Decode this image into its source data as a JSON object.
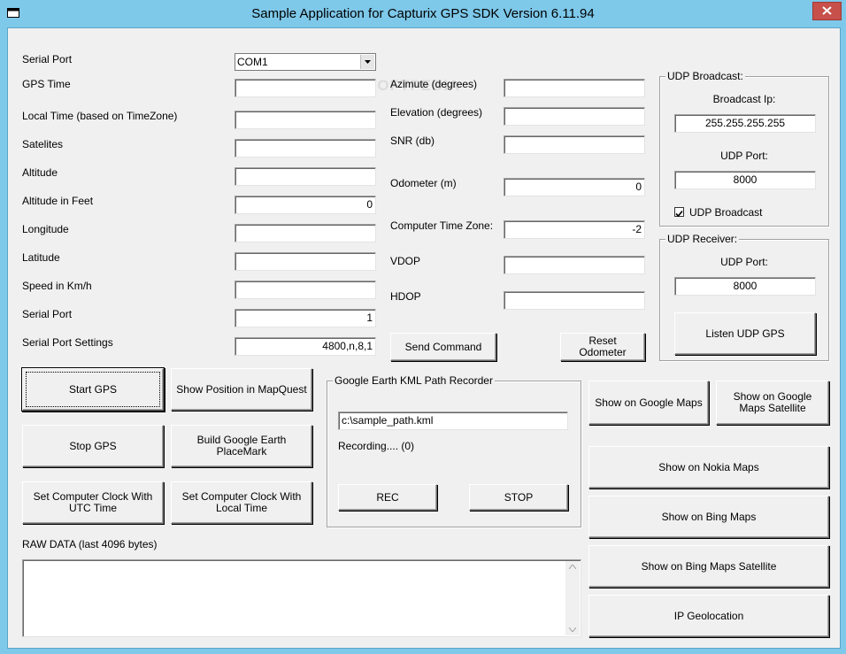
{
  "window": {
    "title": "Sample Application for Capturix GPS SDK  Version 6.11.94"
  },
  "watermark": "SOFTPEDIA",
  "left_fields": [
    {
      "label": "GPS Time",
      "value": ""
    },
    {
      "label": "Local Time (based on TimeZone)",
      "value": ""
    },
    {
      "label": "Satelites",
      "value": ""
    },
    {
      "label": "Altitude",
      "value": ""
    },
    {
      "label": "Altitude in Feet",
      "value": "0"
    },
    {
      "label": "Longitude",
      "value": ""
    },
    {
      "label": "Latitude",
      "value": ""
    },
    {
      "label": "Speed in Km/h",
      "value": ""
    },
    {
      "label": "Serial Port",
      "value": "1"
    },
    {
      "label": "Serial Port Settings",
      "value": "4800,n,8,1"
    }
  ],
  "serial_port": {
    "label": "Serial Port",
    "selected": "COM1"
  },
  "mid_fields": [
    {
      "label": "Azimute (degrees)",
      "value": ""
    },
    {
      "label": "Elevation (degrees)",
      "value": ""
    },
    {
      "label": "SNR (db)",
      "value": ""
    },
    {
      "label": "Odometer (m)",
      "value": "0"
    },
    {
      "label": "Computer Time Zone:",
      "value": "-2"
    },
    {
      "label": "VDOP",
      "value": ""
    },
    {
      "label": "HDOP",
      "value": ""
    }
  ],
  "buttons": {
    "send_command": "Send Command",
    "reset_odometer": "Reset Odometer",
    "start_gps": "Start GPS",
    "show_mapquest": "Show Position in MapQuest",
    "stop_gps": "Stop GPS",
    "build_placemark": "Build Google Earth PlaceMark",
    "set_clock_utc": "Set Computer Clock With UTC Time",
    "set_clock_local": "Set Computer Clock With Local Time",
    "rec": "REC",
    "stop": "STOP",
    "listen_udp": "Listen UDP GPS",
    "google_maps": "Show on Google Maps",
    "google_maps_sat": "Show on Google Maps Satellite",
    "nokia_maps": "Show on Nokia Maps",
    "bing_maps": "Show on Bing Maps",
    "bing_maps_sat": "Show on Bing Maps Satellite",
    "ip_geo": "IP Geolocation"
  },
  "udp_broadcast": {
    "title": "UDP Broadcast:",
    "ip_label": "Broadcast Ip:",
    "ip_value": "255.255.255.255",
    "port_label": "UDP Port:",
    "port_value": "8000",
    "checkbox_label": "UDP Broadcast",
    "checked": true
  },
  "udp_receiver": {
    "title": "UDP Receiver:",
    "port_label": "UDP Port:",
    "port_value": "8000"
  },
  "kml": {
    "title": "Google Earth KML Path Recorder",
    "path": "c:\\sample_path.kml",
    "status": "Recording.... (0)"
  },
  "raw": {
    "label": "RAW DATA (last 4096 bytes)",
    "content": ""
  }
}
